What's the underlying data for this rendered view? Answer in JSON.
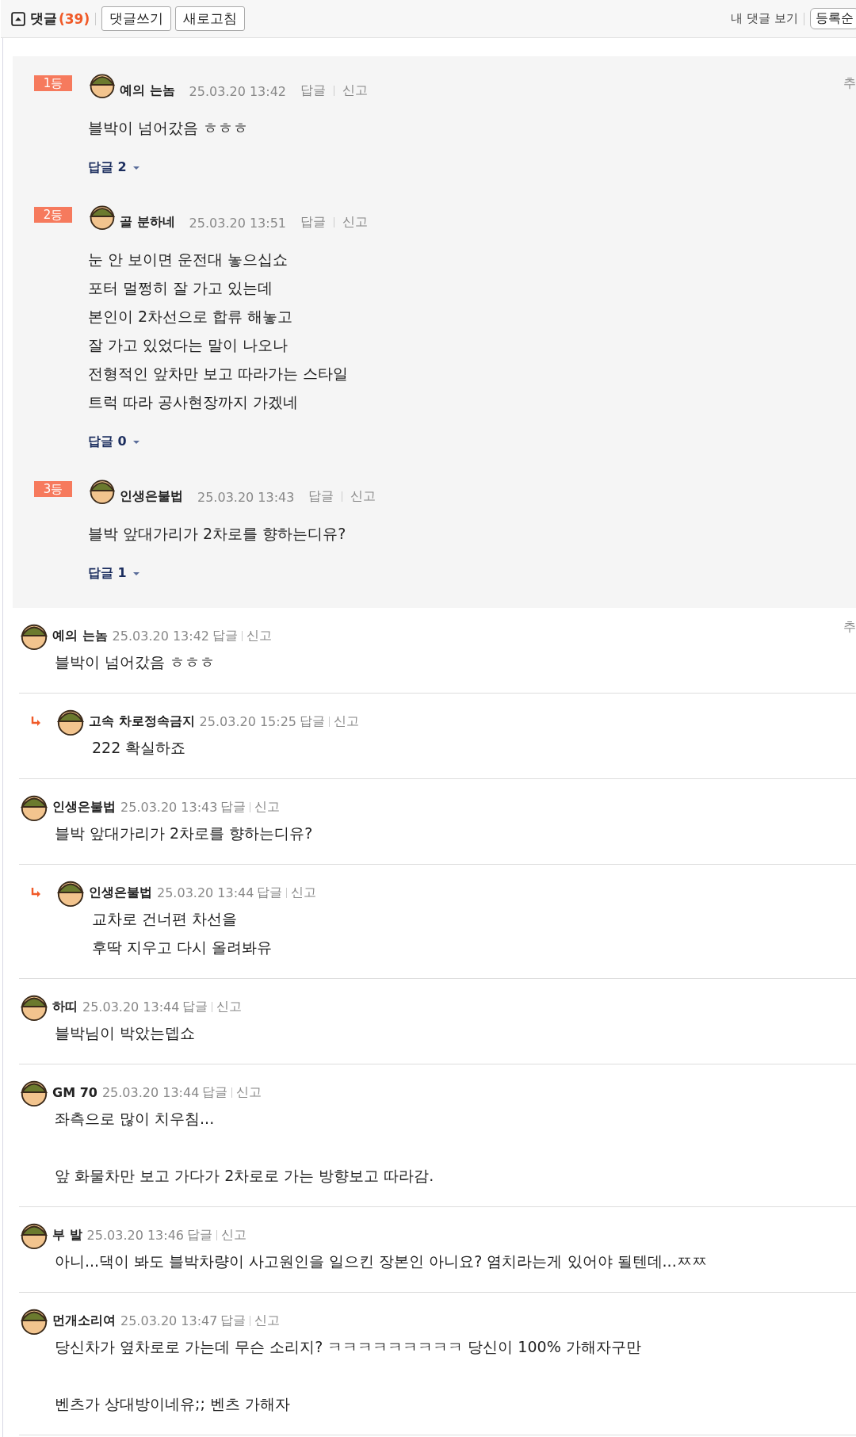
{
  "header": {
    "title": "댓글",
    "count": "(39)",
    "buttons": [
      "댓글쓰기",
      "새로고침"
    ],
    "my_comments_link": "내 댓글 보기",
    "sort_button": "등록순"
  },
  "best_comments": [
    {
      "rank": "1등",
      "author": "예의 는놈",
      "date": "25.03.20 13:42",
      "reply_link": "답글",
      "report_link": "신고",
      "side_text": "추",
      "paragraphs": [
        [
          "블박이 넘어갔음 ㅎㅎㅎ"
        ]
      ],
      "replies_toggle": "답글 2"
    },
    {
      "rank": "2등",
      "author": "골 분하네",
      "date": "25.03.20 13:51",
      "reply_link": "답글",
      "report_link": "신고",
      "paragraphs": [
        [
          "눈 안 보이면 운전대 놓으십쇼",
          "포터 멀쩡히 잘 가고 있는데",
          "본인이 2차선으로 합류 해놓고",
          "잘 가고 있었다는 말이 나오나",
          "전형적인 앞차만 보고 따라가는 스타일",
          "트럭 따라 공사현장까지 가겠네"
        ]
      ],
      "replies_toggle": "답글 0"
    },
    {
      "rank": "3등",
      "author": "인생은불법",
      "date": "25.03.20 13:43",
      "reply_link": "답글",
      "report_link": "신고",
      "paragraphs": [
        [
          "블박 앞대가리가 2차로를 향하는디유?"
        ]
      ],
      "replies_toggle": "답글 1"
    }
  ],
  "comments": [
    {
      "kind": "comment",
      "author": "예의 는놈",
      "date": "25.03.20 13:42",
      "reply_link": "답글",
      "report_link": "신고",
      "side_text": "추",
      "paragraphs": [
        [
          "블박이 넘어갔음 ㅎㅎㅎ"
        ]
      ]
    },
    {
      "kind": "reply",
      "author": "고속 차로정속금지",
      "date": "25.03.20 15:25",
      "reply_link": "답글",
      "report_link": "신고",
      "paragraphs": [
        [
          "222 확실하죠"
        ]
      ]
    },
    {
      "kind": "comment",
      "author": "인생은불법",
      "date": "25.03.20 13:43",
      "reply_link": "답글",
      "report_link": "신고",
      "paragraphs": [
        [
          "블박 앞대가리가 2차로를 향하는디유?"
        ]
      ]
    },
    {
      "kind": "reply",
      "author": "인생은불법",
      "date": "25.03.20 13:44",
      "reply_link": "답글",
      "report_link": "신고",
      "paragraphs": [
        [
          "교차로 건너편 차선을",
          "후딱 지우고 다시 올려봐유"
        ]
      ]
    },
    {
      "kind": "comment",
      "author": "하띠",
      "date": "25.03.20 13:44",
      "reply_link": "답글",
      "report_link": "신고",
      "paragraphs": [
        [
          "블박님이 박았는뎁쇼"
        ]
      ]
    },
    {
      "kind": "comment",
      "author": "GM 70",
      "date": "25.03.20 13:44",
      "reply_link": "답글",
      "report_link": "신고",
      "paragraphs": [
        [
          "좌측으로 많이 치우침..."
        ],
        [
          "앞 화물차만 보고 가다가 2차로로 가는 방향보고 따라감."
        ]
      ]
    },
    {
      "kind": "comment",
      "author": "부 발",
      "date": "25.03.20 13:46",
      "reply_link": "답글",
      "report_link": "신고",
      "paragraphs": [
        [
          "아니...댁이 봐도 블박차량이 사고원인을 일으킨 장본인 아니요? 염치라는게 있어야 될텐데...ㅉㅉ"
        ]
      ]
    },
    {
      "kind": "comment",
      "author": "먼개소리여",
      "date": "25.03.20 13:47",
      "reply_link": "답글",
      "report_link": "신고",
      "paragraphs": [
        [
          "당신차가 옆차로로 가는데 무슨 소리지? ㅋㅋㅋㅋㅋㅋㅋㅋㅋ 당신이 100% 가해자구만"
        ],
        [
          "벤츠가 상대방이네유;; 벤츠 가해자"
        ]
      ]
    }
  ]
}
